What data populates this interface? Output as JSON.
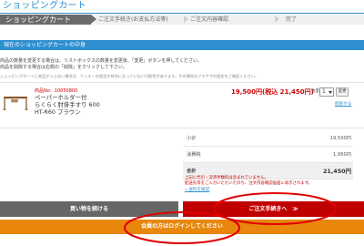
{
  "page": {
    "title": "ショッピングカート"
  },
  "steps": [
    {
      "label": "ショッピングカート",
      "active": true
    },
    {
      "label": "ご注文手続き(お支払方法等)",
      "active": false
    },
    {
      "label": "ご注文内容確認",
      "active": false
    },
    {
      "label": "完了",
      "active": false
    }
  ],
  "cart": {
    "section_title": "現在のショッピングカートの中身",
    "instructions": [
      "商品の数量を変更する場合は、リストボックスの数量を変更後、「変更」ボタンを押してください。",
      "商品を削除する場合は右側の「削除」をクリックして下さい。"
    ],
    "cookie_note": "ショッピングカートに商品が入らない場合は、クッキーの設定が有効になっていない可能性があります。その場合はブラウザの設定をご確認ください。",
    "items": [
      {
        "product_no": "商品No：10050800",
        "name_lines": [
          "ペーパーホルダー付",
          "らくらく肘掛手すり 600",
          "HT-R60 ブラウン"
        ],
        "price": "19,500円(税込 21,450円)",
        "quantity_label": "数量",
        "quantity": "1",
        "change_label": "変更",
        "delete_label": "削除する"
      }
    ]
  },
  "summary": {
    "subtotal_label": "小計",
    "subtotal_value": "19,500円",
    "tax_label": "消費税",
    "tax_value": "1,950円",
    "total_label": "合計",
    "total_value": "21,450円"
  },
  "notices": [
    "上記に代引・決済手数料は含まれていません。",
    "配送先等をご入力いただいたのち、注文内容確認画面に表示されます。"
  ],
  "shipping_link": "» 送料を確認",
  "buttons": {
    "continue": "買い物を続ける",
    "checkout": "ご注文手続きへ　≫",
    "login": "会員の方はログインしてください"
  },
  "colors": {
    "brand_blue": "#2f8fd0",
    "price_red": "#cc0000",
    "checkout_red": "#c00000",
    "login_orange": "#e8870c",
    "annotation_red": "#e00000"
  }
}
